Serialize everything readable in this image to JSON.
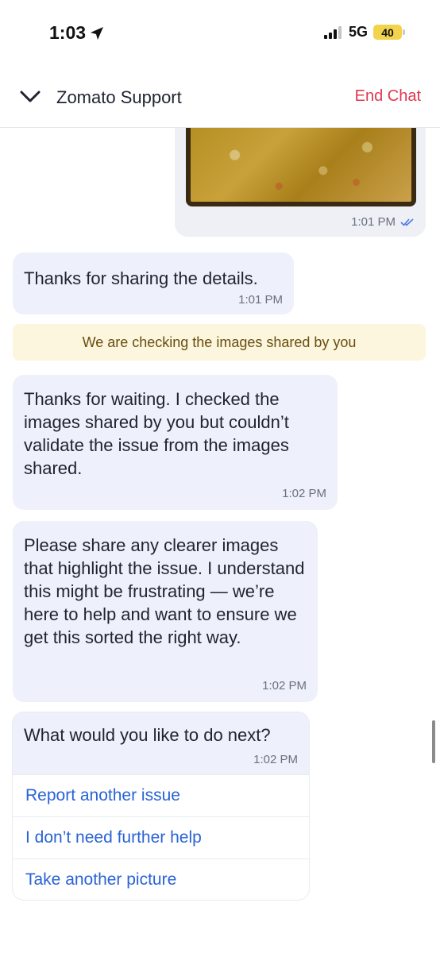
{
  "status_bar": {
    "time": "1:03",
    "network": "5G",
    "battery": "40",
    "icons": [
      "location-arrow-icon",
      "signal-bars-icon",
      "battery-icon"
    ]
  },
  "header": {
    "title": "Zomato Support",
    "end_chat_label": "End Chat",
    "back_icon": "chevron-down-icon",
    "accent_color": "#e0384f"
  },
  "messages": [
    {
      "sender": "user",
      "type": "image",
      "time": "1:01 PM",
      "status_icon": "double-check-icon"
    },
    {
      "sender": "agent",
      "text": "Thanks for sharing the details.",
      "time": "1:01 PM"
    },
    {
      "sender": "system",
      "text": "We are checking the images shared by you"
    },
    {
      "sender": "agent",
      "text": "Thanks for waiting. I checked the images shared by you but couldn’t validate the issue from the images shared.",
      "time": "1:02 PM"
    },
    {
      "sender": "agent",
      "text": "Please share any clearer images that highlight the issue. I understand this might be frustrating — we’re here to help and want to ensure we get this sorted the right way.",
      "time": "1:02 PM"
    }
  ],
  "prompt": {
    "question": "What would you like to do next?",
    "time": "1:02 PM",
    "options": [
      "Report another issue",
      "I don’t need further help",
      "Take another picture"
    ],
    "option_color": "#2a63d6"
  }
}
